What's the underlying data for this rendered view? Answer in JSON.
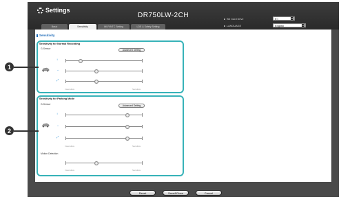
{
  "header": {
    "title": "Settings",
    "model": "DR750LW-2CH",
    "tabs": [
      {
        "label": "Basic"
      },
      {
        "label": "Sensitivity"
      },
      {
        "label": "Wi-Fi/NTC Setting"
      },
      {
        "label": "LDE & Safety Setting"
      }
    ],
    "sd_card_label": "SD Card Drive",
    "sd_card_value": "E:\\",
    "language_label": "LANGUAGE",
    "language_value": "English"
  },
  "section_title": "Sensitivity",
  "normal": {
    "title": "Sensitivity for Normal Recording",
    "gsensor_label": "G-Sensor",
    "advanced_label": "Advanced Setting",
    "levels": [
      0.2,
      0.4,
      0.4
    ],
    "insensitive": "Insensitive",
    "sensitive": "Sensitive"
  },
  "parking": {
    "title": "Sensitivity for Parking Mode",
    "gsensor_label": "G-Sensor",
    "advanced_label": "Advanced Setting",
    "levels": [
      0.8,
      0.8,
      0.8
    ],
    "insensitive": "Insensitive",
    "sensitive": "Sensitive",
    "motion_label": "Motion Detection",
    "motion_level": 0.4,
    "motion_insensitive": "Insensitive",
    "motion_sensitive": "Sensitive"
  },
  "callouts": [
    "1",
    "2"
  ],
  "footer": {
    "reset": "Reset",
    "save_close": "Save&Close",
    "cancel": "Cancel"
  },
  "icons": [
    "gear-icon",
    "car-icon",
    "axis-x-icon",
    "axis-y-icon",
    "axis-z-icon",
    "dropdown-arrow-icon"
  ],
  "colors": {
    "panel_border": "#36b2b8",
    "frame": "#4a4a4a",
    "accent_text": "#1e6bb8"
  }
}
